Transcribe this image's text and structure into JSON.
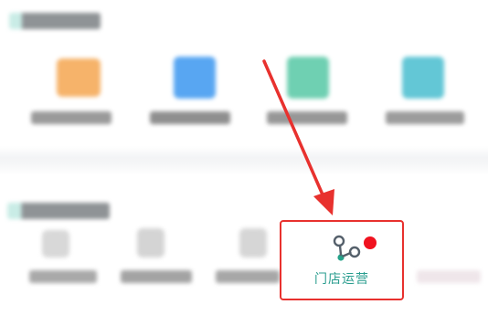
{
  "colors": {
    "accent_red": "#e8312e",
    "text_green": "#2a9d8f",
    "icon_dark": "#55606b",
    "icon_green": "#26a38a",
    "notification_dot": "#f0121f"
  },
  "top_section": {
    "apps": [
      {
        "icon": "orange-folder-icon",
        "color": "#f6b36a"
      },
      {
        "icon": "blue-app-icon",
        "color": "#58a6f2"
      },
      {
        "icon": "green-app-icon",
        "color": "#6fd0b2"
      },
      {
        "icon": "teal-app-icon",
        "color": "#63c7d6"
      }
    ]
  },
  "bottom_section": {
    "store_ops": {
      "label": "门店运营",
      "icon": "branch-nodes-icon",
      "has_notification": true
    }
  },
  "annotation": {
    "icon": "red-arrow-icon"
  }
}
